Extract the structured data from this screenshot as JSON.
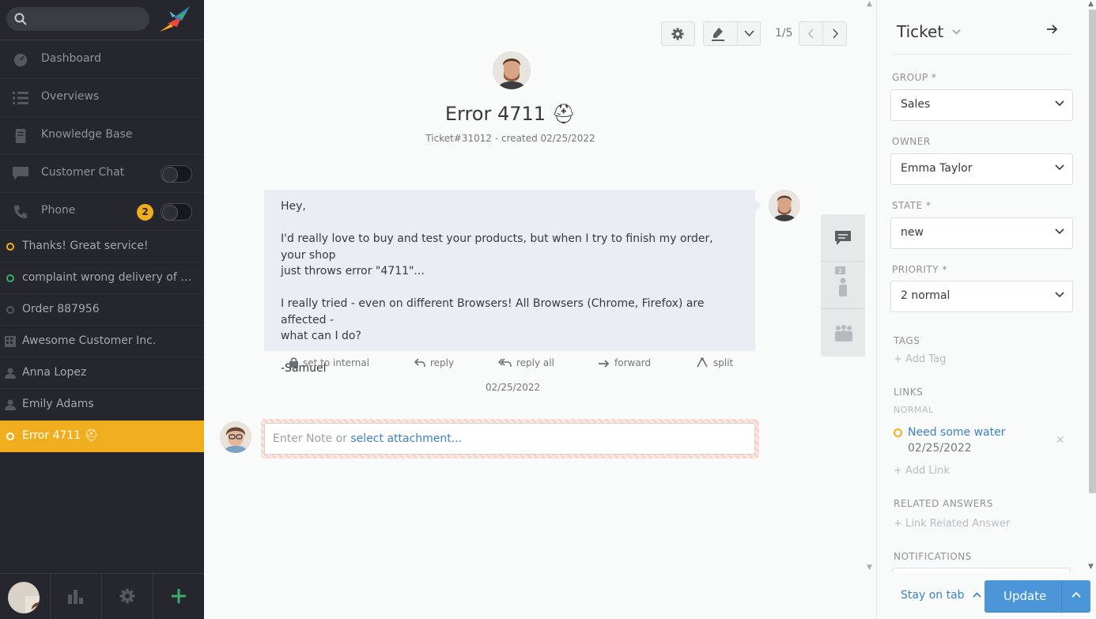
{
  "sidebar": {
    "search": {
      "placeholder": ""
    },
    "nav": [
      {
        "label": "Dashboard",
        "icon": "dashboard-icon"
      },
      {
        "label": "Overviews",
        "icon": "list-icon"
      },
      {
        "label": "Knowledge Base",
        "icon": "book-icon"
      },
      {
        "label": "Customer Chat",
        "icon": "chat-icon"
      },
      {
        "label": "Phone",
        "icon": "phone-icon",
        "badge": "2"
      }
    ],
    "tasks": [
      {
        "label": "Thanks! Great service!",
        "status_color": "#f0ae1e"
      },
      {
        "label": "complaint wrong delivery of order",
        "status_color": "#38ad69"
      },
      {
        "label": "Order 887956",
        "status_color": "#8f949a"
      },
      {
        "label": "Awesome Customer Inc.",
        "icon": "building-icon"
      },
      {
        "label": "Anna Lopez",
        "icon": "person-icon"
      },
      {
        "label": "Emily Adams",
        "icon": "person-icon"
      },
      {
        "label": "Error 4711 ⛑",
        "status_color": "#ffffff",
        "active": true
      }
    ]
  },
  "toolbar": {
    "pager": "1/5"
  },
  "ticket": {
    "title": "Error 4711 ⛑",
    "meta": "Ticket#31012 - created 02/25/2022"
  },
  "article": {
    "paragraphs": [
      "Hey,",
      "I'd really love to buy and test your products, but when I try to finish my order, your shop\njust throws error \"4711\"...",
      "I really tried - even on different Browsers! All Browsers (Chrome, Firefox) are affected -\nwhat can I do?",
      "-Samuel"
    ],
    "actions": {
      "internal": "set to internal",
      "reply": "reply",
      "reply_all": "reply all",
      "forward": "forward",
      "split": "split"
    },
    "date": "02/25/2022"
  },
  "note": {
    "placeholder": "Enter Note or ",
    "attachment_link": "select attachment..."
  },
  "panel": {
    "title": "Ticket",
    "group": {
      "label": "GROUP *",
      "value": "Sales"
    },
    "owner": {
      "label": "OWNER",
      "value": "Emma Taylor"
    },
    "state": {
      "label": "STATE *",
      "value": "new"
    },
    "priority": {
      "label": "PRIORITY *",
      "value": "2 normal"
    },
    "tags": {
      "label": "TAGS",
      "add": "+ Add Tag"
    },
    "links": {
      "label": "LINKS",
      "sub": "NORMAL",
      "item": "Need some water",
      "item_date": "02/25/2022",
      "add": "+ Add Link"
    },
    "related": {
      "label": "RELATED ANSWERS",
      "add": "+ Link Related Answer"
    },
    "notifications": {
      "label": "NOTIFICATIONS"
    }
  },
  "footer": {
    "stay": "Stay on tab",
    "update": "Update"
  },
  "colors": {
    "accent": "#f0ae1e",
    "primary": "#4a96d8",
    "link": "#3b82c4",
    "sidebar": "#26272e"
  }
}
